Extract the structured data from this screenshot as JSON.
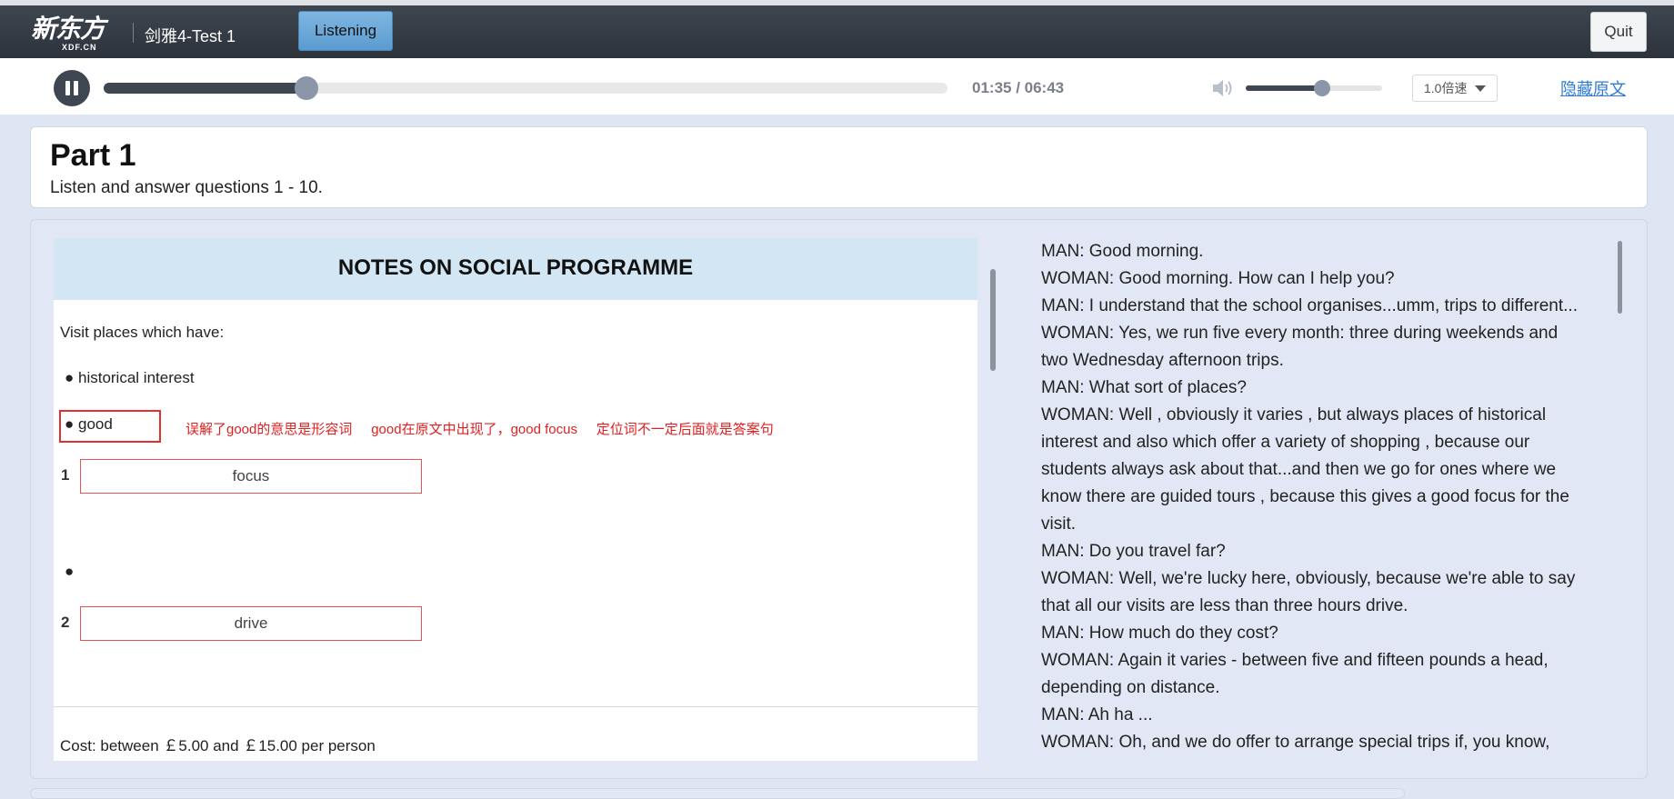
{
  "header": {
    "logo_cn": "新东方",
    "logo_en": "XDF.CN",
    "test_title": "剑雅4-Test 1",
    "mode_button": "Listening",
    "quit_button": "Quit"
  },
  "player": {
    "progress_fraction": 0.24,
    "time": "01:35 / 06:43",
    "volume_fraction": 0.56,
    "speed": "1.0倍速",
    "hide_transcript_link": "隐藏原文",
    "icons": [
      "pause-icon",
      "volume-icon",
      "chevron-down-icon"
    ]
  },
  "part": {
    "title": "Part 1",
    "subtitle": "Listen and answer questions 1 - 10."
  },
  "notes": {
    "heading": "NOTES ON SOCIAL PROGRAMME",
    "intro": "Visit places which have:",
    "bullet1": "● historical interest",
    "bullet2": "● good",
    "annotation": "误解了good的意思是形容词     good在原文中出现了，good focus     定位词不一定后面就是答案句",
    "q1_num": "1",
    "q1_answer": "focus",
    "bullet3": "●",
    "q2_num": "2",
    "q2_answer": "drive",
    "cost": "Cost:  between  ￡5.00 and  ￡15.00 per person"
  },
  "transcript": [
    "MAN: Good morning.",
    "WOMAN: Good morning. How can I help you?",
    "MAN: I understand that the school organises...umm, trips to different...",
    "WOMAN: Yes, we run five every month: three during weekends and",
    "two Wednesday afternoon trips.",
    "MAN: What sort of places?",
    "WOMAN: Well , obviously it varies , but always places of historical",
    "interest and also which offer a variety of shopping , because our",
    "students always ask about that...and then we go for ones where we",
    "know there are guided tours , because this gives a good focus for the",
    "visit.",
    "MAN: Do you travel far?",
    "WOMAN: Well, we're lucky here, obviously, because we're able to say",
    "that all our visits are less than three hours drive.",
    "MAN: How much do they cost?",
    "WOMAN: Again it varies - between five and fifteen pounds a head,",
    "depending on distance.",
    "MAN: Ah ha ...",
    "WOMAN: Oh, and we do offer to arrange special trips if, you know,"
  ]
}
